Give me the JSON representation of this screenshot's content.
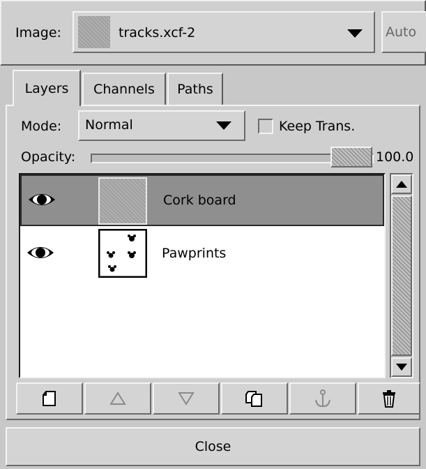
{
  "image_row": {
    "label": "Image:",
    "selected_image": "tracks.xcf-2",
    "auto_button": "Auto",
    "dropdown_icon": "triangle-down-icon"
  },
  "tabs": [
    {
      "label": "Layers",
      "active": true
    },
    {
      "label": "Channels",
      "active": false
    },
    {
      "label": "Paths",
      "active": false
    }
  ],
  "mode_row": {
    "label": "Mode:",
    "value": "Normal",
    "keep_trans_label": "Keep Trans.",
    "keep_trans_checked": false
  },
  "opacity": {
    "label": "Opacity:",
    "value": "100.0",
    "fraction": 1.0
  },
  "layers": [
    {
      "name": "Cork board",
      "visible": true,
      "selected": true,
      "thumbnail": "cork-texture"
    },
    {
      "name": "Pawprints",
      "visible": true,
      "selected": false,
      "thumbnail": "pawprints"
    }
  ],
  "toolbar": [
    {
      "name": "new-layer-button",
      "icon": "new-page-icon",
      "enabled": true
    },
    {
      "name": "raise-layer-button",
      "icon": "triangle-up-icon",
      "enabled": false
    },
    {
      "name": "lower-layer-button",
      "icon": "triangle-down-icon",
      "enabled": false
    },
    {
      "name": "duplicate-layer-button",
      "icon": "duplicate-icon",
      "enabled": true
    },
    {
      "name": "anchor-layer-button",
      "icon": "anchor-icon",
      "enabled": false
    },
    {
      "name": "delete-layer-button",
      "icon": "trash-icon",
      "enabled": true
    }
  ],
  "close_button": "Close",
  "colors": {
    "window_bg": "#c8c8c8",
    "selected_row": "#8f8f8f",
    "list_bg": "#ffffff"
  }
}
